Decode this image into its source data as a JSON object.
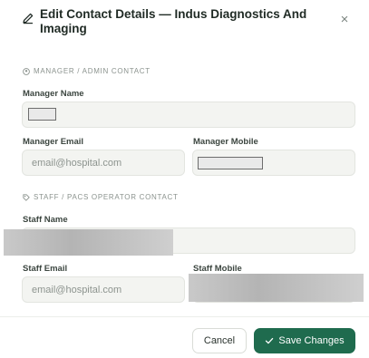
{
  "dialog": {
    "title": "Edit Contact Details — Indus Diagnostics And Imaging",
    "close_glyph": "×"
  },
  "manager_section": {
    "heading": "MANAGER / ADMIN CONTACT",
    "name_label": "Manager Name",
    "email_label": "Manager Email",
    "email_placeholder": "email@hospital.com",
    "mobile_label": "Manager Mobile"
  },
  "staff_section": {
    "heading": "STAFF / PACS OPERATOR CONTACT",
    "name_label": "Staff Name",
    "email_label": "Staff Email",
    "email_placeholder": "email@hospital.com",
    "mobile_label": "Staff Mobile"
  },
  "footer": {
    "cancel_label": "Cancel",
    "save_label": "Save Changes"
  },
  "colors": {
    "primary": "#1f6b4e",
    "field_bg": "#f3f4f1",
    "muted_text": "#8b938e"
  },
  "icons": [
    "edit-icon",
    "close-icon",
    "user-circle-icon",
    "tag-icon",
    "check-icon"
  ]
}
